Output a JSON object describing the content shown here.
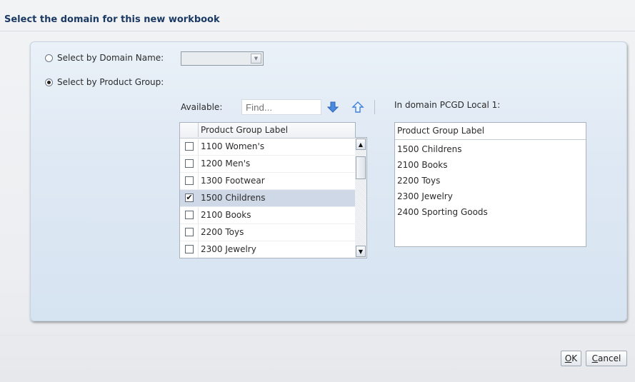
{
  "dialog": {
    "title": "Select the domain for this new workbook"
  },
  "options": {
    "by_domain_name_label": "Select by Domain Name:",
    "by_product_group_label": "Select by Product Group:",
    "selected": "product_group",
    "domain_name_value": ""
  },
  "available": {
    "label": "Available:",
    "find_placeholder": "Find...",
    "column_header": "Product Group Label",
    "rows": [
      {
        "label": "1100 Women's",
        "checked": false
      },
      {
        "label": "1200 Men's",
        "checked": false
      },
      {
        "label": "1300 Footwear",
        "checked": false
      },
      {
        "label": "1500 Childrens",
        "checked": true
      },
      {
        "label": "2100 Books",
        "checked": false
      },
      {
        "label": "2200 Toys",
        "checked": false
      },
      {
        "label": "2300 Jewelry",
        "checked": false
      }
    ],
    "move_down_icon": "arrow-down-icon",
    "move_up_icon": "arrow-up-icon"
  },
  "in_domain": {
    "label": "In domain PCGD Local 1:",
    "column_header": "Product Group Label",
    "items": [
      "1500 Childrens",
      "2100 Books",
      "2200 Toys",
      "2300 Jewelry",
      "2400 Sporting Goods"
    ]
  },
  "buttons": {
    "ok_mnemonic": "O",
    "ok_rest": "K",
    "cancel_mnemonic": "C",
    "cancel_rest": "ancel"
  },
  "colors": {
    "title": "#1b3a63",
    "panel": "#dfe9f4",
    "arrow": "#3d7fd9",
    "selected_row": "#cfd8e6"
  }
}
